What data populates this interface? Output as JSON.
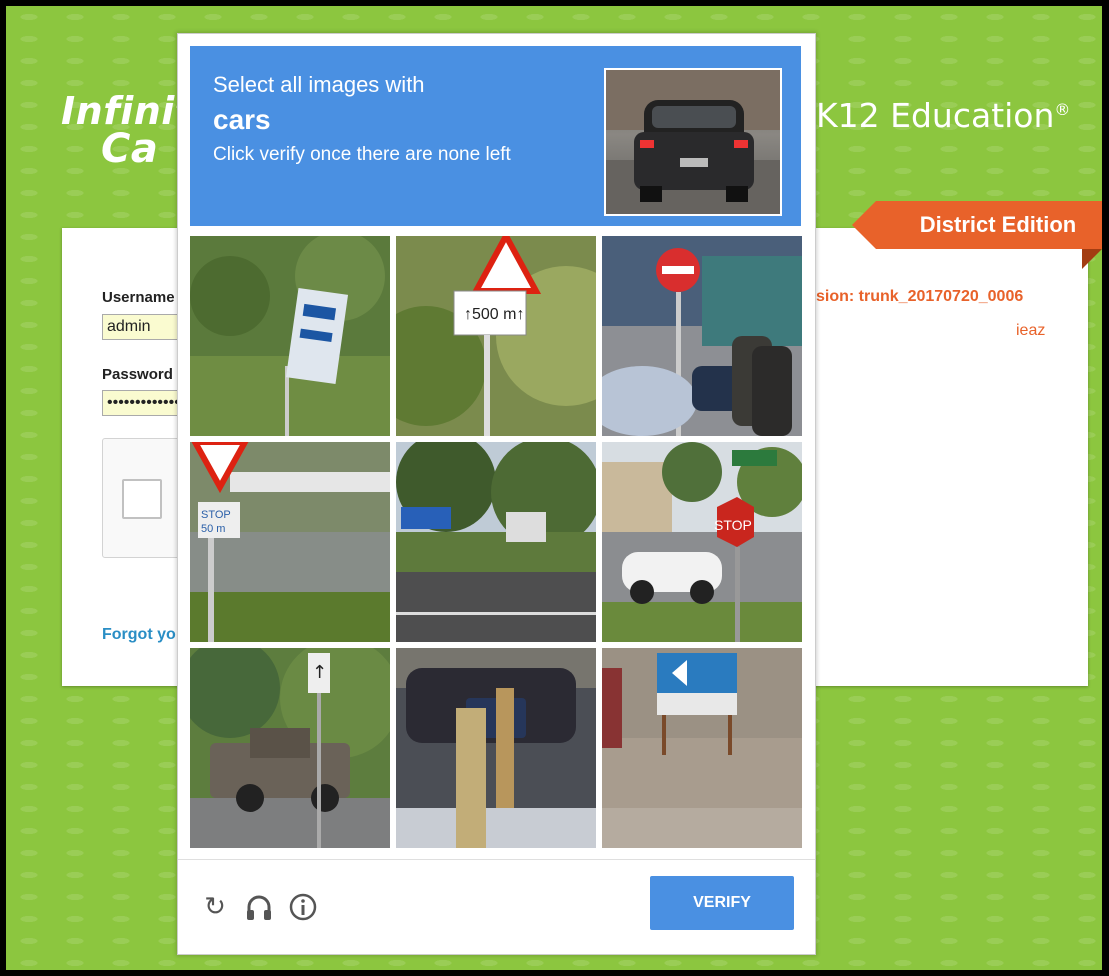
{
  "logo": {
    "left_line1": "Infinit",
    "left_line2": "Ca",
    "right": "K12 Education",
    "right_mark": "®"
  },
  "edition": "District Edition",
  "version": "sion: trunk_20170720_0006",
  "app_code": "ieaz",
  "login": {
    "username_label": "Username",
    "username_value": "admin",
    "password_label": "Password",
    "password_value": "•••••••••••••",
    "forgot_label": "Forgot yo"
  },
  "captcha": {
    "instruction_line1": "Select all images with",
    "target": "cars",
    "instruction_line3": "Click verify once there are none left",
    "sample_image": "car-rear-view",
    "tiles": [
      {
        "scene": "bus-stop-sign-grass"
      },
      {
        "scene": "warning-sign-500m"
      },
      {
        "scene": "no-entry-sign-street-cars"
      },
      {
        "scene": "yield-sign-stop-50m"
      },
      {
        "scene": "roadside-blue-sign"
      },
      {
        "scene": "stop-sign-white-car"
      },
      {
        "scene": "pickup-truck-road-sign"
      },
      {
        "scene": "parking-sign-cars"
      },
      {
        "scene": "arrow-sign-gravel"
      }
    ],
    "icons": {
      "reload": "reload-icon",
      "audio": "headphones-icon",
      "info": "info-icon"
    },
    "verify_label": "VERIFY"
  }
}
